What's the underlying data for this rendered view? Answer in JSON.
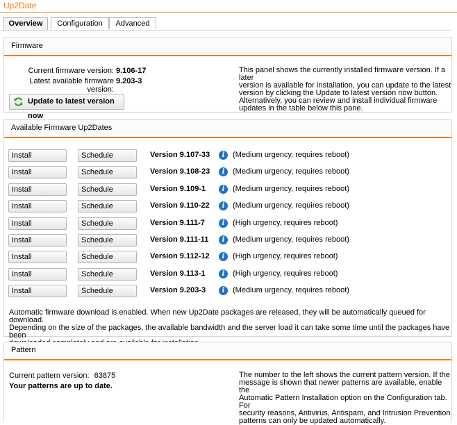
{
  "app": {
    "title": "Up2Date"
  },
  "tabs": [
    {
      "label": "Overview",
      "active": true
    },
    {
      "label": "Configuration",
      "active": false
    },
    {
      "label": "Advanced",
      "active": false
    }
  ],
  "firmware": {
    "header": "Firmware",
    "current_label": "Current firmware version:",
    "current_value": "9.106-17",
    "latest_label": "Latest available firmware version:",
    "latest_value": "9.203-3",
    "update_button": "Update to latest version now",
    "description": [
      "This panel shows the currently installed firmware version. If a later",
      "version is available for installation, you can update to the latest",
      "version by clicking the Update to latest version now button.",
      "Alternatively, you can review and install individual firmware",
      "updates in the table below this pane."
    ]
  },
  "available": {
    "header": "Available Firmware Up2Dates",
    "install_label": "Install",
    "schedule_label": "Schedule",
    "rows": [
      {
        "version": "Version 9.107-33",
        "urgency": "(Medium urgency, requires reboot)"
      },
      {
        "version": "Version 9.108-23",
        "urgency": "(Medium urgency, requires reboot)"
      },
      {
        "version": "Version 9.109-1",
        "urgency": "(Medium urgency, requires reboot)"
      },
      {
        "version": "Version 9.110-22",
        "urgency": "(Medium urgency, requires reboot)"
      },
      {
        "version": "Version 9.111-7",
        "urgency": "(High urgency, requires reboot)"
      },
      {
        "version": "Version 9.111-11",
        "urgency": "(Medium urgency, requires reboot)"
      },
      {
        "version": "Version 9.112-12",
        "urgency": "(High urgency, requires reboot)"
      },
      {
        "version": "Version 9.113-1",
        "urgency": "(High urgency, requires reboot)"
      },
      {
        "version": "Version 9.203-3",
        "urgency": "(Medium urgency, requires reboot)"
      }
    ],
    "notice": [
      "Automatic firmware download is enabled. When new Up2Date packages are released, they will be automatically queued for download.",
      "Depending on the size of the packages, the available bandwidth and the server load it can take some time until the packages have been",
      "downloaded completely and are available for installation."
    ]
  },
  "pattern": {
    "header": "Pattern",
    "current_label": "Current pattern version:",
    "current_value": "63875",
    "status": "Your patterns are up to date.",
    "description": [
      "The number to the left shows the current pattern version. If the",
      "message is shown that newer patterns are available, enable the",
      "Automatic Pattern Installation option on the Configuration tab. For",
      "security reasons, Antivirus, Antispam, and Intrusion Prevention",
      "patterns can only be updated automatically."
    ]
  },
  "colors": {
    "accent": "#f07d00",
    "info": "#1e73c8",
    "refresh": "#3a9a2a"
  },
  "icons": {
    "update": "refresh-icon",
    "row_info": "info-icon"
  }
}
